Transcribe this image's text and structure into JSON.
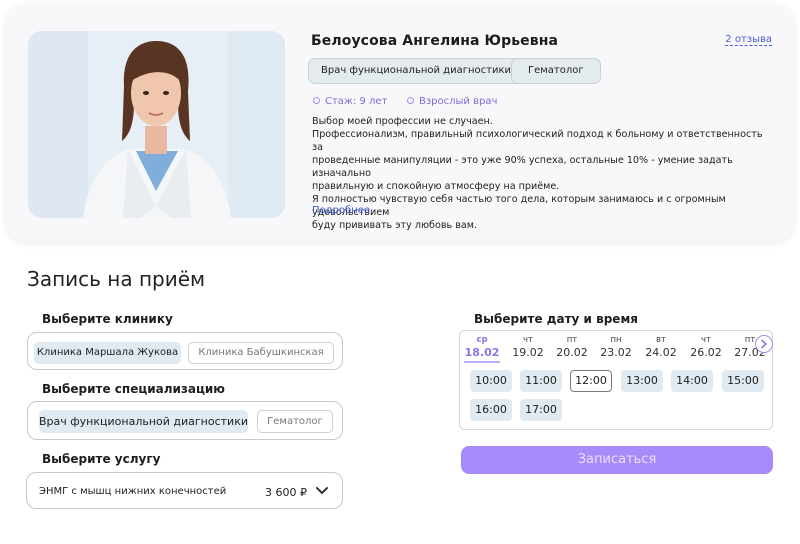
{
  "doctor": {
    "name": "Белоусова Ангелина Юрьевна",
    "reviews": "2 отзыва",
    "specialties": [
      "Врач функциональной диагностики",
      "Гематолог"
    ],
    "experience": "Стаж: 9 лет",
    "patient_type": "Взрослый врач",
    "bio": [
      "Выбор моей профессии не случаен.",
      "Профессионализм, правильный психологический подход к больному и ответственность за",
      "проведенные манипуляции - это уже 90% успеха, остальные 10% - умение задать изначально",
      "правильную и спокойную атмосферу на приёме.",
      "Я полностью чувствую себя частью того дела, которым занимаюсь и с огромным удовольствием",
      "буду прививать эту любовь вам."
    ],
    "more_link": "Подробнее"
  },
  "booking": {
    "title": "Запись на приём",
    "clinic_label": "Выберите клинику",
    "clinics": [
      "Клиника Маршала Жукова",
      "Клиника Бабушкинская"
    ],
    "spec_label": "Выберите специализацию",
    "specs": [
      "Врач функциональной диагностики",
      "Гематолог"
    ],
    "service_label": "Выберите услугу",
    "service": {
      "name": "ЭНМГ с мышц нижних конечностей",
      "price": "3 600 ₽"
    },
    "date_label": "Выберите дату и время",
    "days": [
      {
        "dw": "ср",
        "dd": "18.02"
      },
      {
        "dw": "чт",
        "dd": "19.02"
      },
      {
        "dw": "пт",
        "dd": "20.02"
      },
      {
        "dw": "пн",
        "dd": "23.02"
      },
      {
        "dw": "вт",
        "dd": "24.02"
      },
      {
        "dw": "чт",
        "dd": "26.02"
      },
      {
        "dw": "пт",
        "dd": "27.02"
      }
    ],
    "selected_day": "18.02",
    "slots": [
      "10:00",
      "11:00",
      "12:00",
      "13:00",
      "14:00",
      "15:00",
      "16:00",
      "17:00"
    ],
    "selected_slot": "12:00",
    "submit": "Записаться"
  },
  "colors": {
    "accent": "#a78bfa",
    "chip": "#e1eaf0",
    "link": "#3f5ad0"
  },
  "icons": [
    "chevron-down-icon",
    "chevron-right-icon",
    "circle-dot-icon"
  ]
}
